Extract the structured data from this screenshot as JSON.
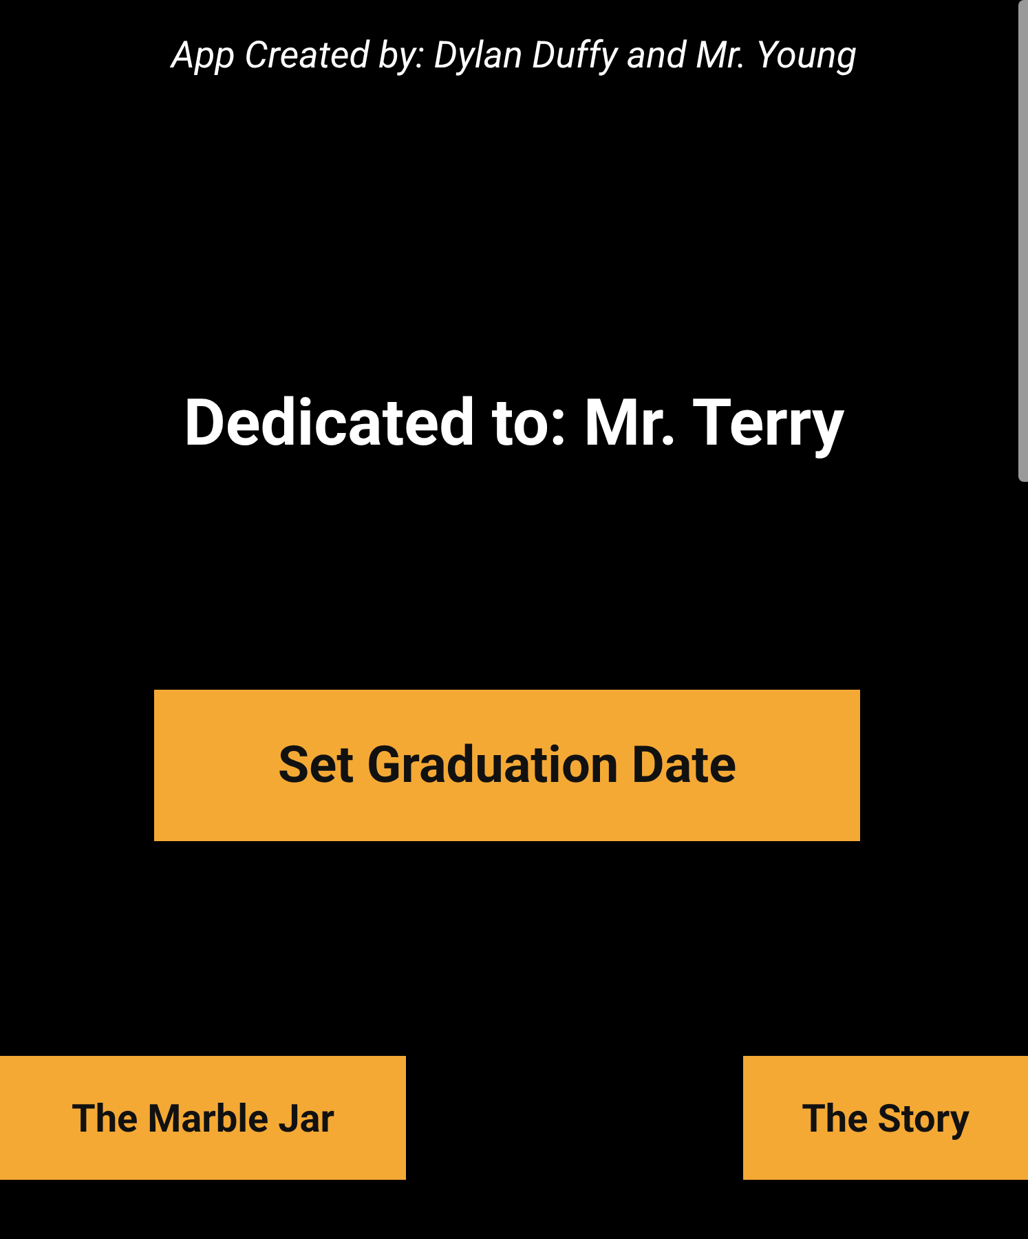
{
  "credit": "App Created by: Dylan Duffy and Mr. Young",
  "dedication": "Dedicated to: Mr. Terry",
  "main_button": "Set Graduation Date",
  "bottom_buttons": [
    "The Marble Jar",
    "The Story"
  ]
}
